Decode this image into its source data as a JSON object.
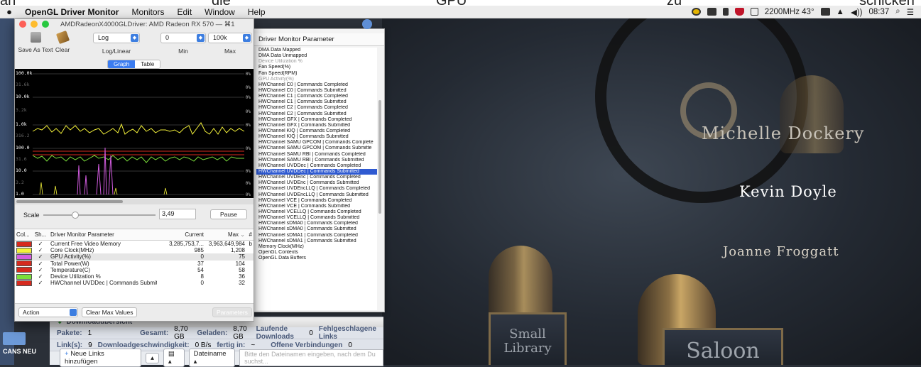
{
  "menubar": {
    "app_name": "OpenGL Driver Monitor",
    "menus": [
      "Monitors",
      "Edit",
      "Window",
      "Help"
    ],
    "cpu_speed": "2200MHz 43°",
    "clock": "08:37"
  },
  "top_strip": {
    "words": [
      "an",
      "die",
      "GPU",
      "zu",
      "schicken"
    ]
  },
  "window": {
    "title": "AMDRadeonX4000GLDriver: AMD Radeon RX 570 — ⌘1",
    "toolbar": {
      "save_label": "Save As Text",
      "clear_label": "Clear",
      "loglinear_value": "Log",
      "loglinear_label": "Log/Linear",
      "min_value": "0",
      "min_label": "Min",
      "max_value": "100k",
      "max_label": "Max"
    },
    "view_tabs": [
      "Graph",
      "Table"
    ],
    "active_tab": "Graph",
    "y_axis_labels": [
      "100.0k",
      "31.6k",
      "10.0k",
      "3.2k",
      "1.0k",
      "316.2",
      "100.0",
      "31.6",
      "10.0",
      "3.2",
      "1.0"
    ],
    "percent_labels": [
      "0%",
      "0%",
      "0%",
      "0%",
      "0%",
      "0%",
      "0%",
      "0%",
      "0%"
    ],
    "scale_label": "Scale",
    "scale_value": "3,49",
    "pause_label": "Pause",
    "table_headers": {
      "color": "Col...",
      "show": "Sh...",
      "name": "Driver Monitor Parameter",
      "current": "Current",
      "max": "Max",
      "hash": "#"
    },
    "parameters": [
      {
        "name": "Current Free Video Memory",
        "current": "3,285,753,7...",
        "max": "3,963,649,984",
        "unit": "b",
        "color": "#d62a1e",
        "shown": "✓"
      },
      {
        "name": "Core Clock(MHz)",
        "current": "985",
        "max": "1,208",
        "unit": "",
        "color": "#f4f23a",
        "shown": "✓"
      },
      {
        "name": "GPU Activity(%)",
        "current": "0",
        "max": "75",
        "unit": "",
        "color": "#d35ce0",
        "shown": "✓"
      },
      {
        "name": "Total Power(W)",
        "current": "37",
        "max": "104",
        "unit": "",
        "color": "#d62a1e",
        "shown": "✓"
      },
      {
        "name": "Temperature(C)",
        "current": "54",
        "max": "58",
        "unit": "",
        "color": "#d62a1e",
        "shown": "✓"
      },
      {
        "name": "Device Utilization %",
        "current": "8",
        "max": "36",
        "unit": "",
        "color": "#7be03a",
        "shown": "✓"
      },
      {
        "name": "HWChannel UVDDec | Commands Submitt",
        "current": "0",
        "max": "32",
        "unit": "",
        "color": "#d62a1e",
        "shown": "✓"
      }
    ],
    "action_label": "Action",
    "clear_max_label": "Clear Max Values",
    "parameters_button": "Parameters"
  },
  "drawer": {
    "header": "Driver Monitor Parameter",
    "items": [
      {
        "label": "DMA Data Mapped",
        "state": "normal"
      },
      {
        "label": "DMA Data Unmapped",
        "state": "normal"
      },
      {
        "label": "Device Utilization %",
        "state": "grey"
      },
      {
        "label": "Fan Speed(%)",
        "state": "normal"
      },
      {
        "label": "Fan Speed(RPM)",
        "state": "normal"
      },
      {
        "label": "GPU Activity(%)",
        "state": "grey"
      },
      {
        "label": "HWChannel C0 | Commands Completed",
        "state": "normal"
      },
      {
        "label": "HWChannel C0 | Commands Submitted",
        "state": "normal"
      },
      {
        "label": "HWChannel C1 | Commands Completed",
        "state": "normal"
      },
      {
        "label": "HWChannel C1 | Commands Submitted",
        "state": "normal"
      },
      {
        "label": "HWChannel C2 | Commands Completed",
        "state": "normal"
      },
      {
        "label": "HWChannel C2 | Commands Submitted",
        "state": "normal"
      },
      {
        "label": "HWChannel GFX | Commands Completed",
        "state": "normal"
      },
      {
        "label": "HWChannel GFX | Commands Submitted",
        "state": "normal"
      },
      {
        "label": "HWChannel KIQ | Commands Completed",
        "state": "normal"
      },
      {
        "label": "HWChannel KIQ | Commands Submitted",
        "state": "normal"
      },
      {
        "label": "HWChannel SAMU GPCOM | Commands Complete",
        "state": "normal"
      },
      {
        "label": "HWChannel SAMU GPCOM | Commands Submitte",
        "state": "normal"
      },
      {
        "label": "HWChannel SAMU RBI | Commands Completed",
        "state": "normal"
      },
      {
        "label": "HWChannel SAMU RBI | Commands Submitted",
        "state": "normal"
      },
      {
        "label": "HWChannel UVDDec | Commands Completed",
        "state": "normal"
      },
      {
        "label": "HWChannel UVDDec | Commands Submitted",
        "state": "selected"
      },
      {
        "label": "HWChannel UVDEnc | Commands Completed",
        "state": "normal"
      },
      {
        "label": "HWChannel UVDEnc | Commands Submitted",
        "state": "normal"
      },
      {
        "label": "HWChannel UVDEncLLQ | Commands Completed",
        "state": "normal"
      },
      {
        "label": "HWChannel UVDEncLLQ | Commands Submitted",
        "state": "normal"
      },
      {
        "label": "HWChannel VCE | Commands Completed",
        "state": "normal"
      },
      {
        "label": "HWChannel VCE | Commands Submitted",
        "state": "normal"
      },
      {
        "label": "HWChannel VCELLQ | Commands Completed",
        "state": "normal"
      },
      {
        "label": "HWChannel VCELLQ | Commands Submitted",
        "state": "normal"
      },
      {
        "label": "HWChannel sDMA0 | Commands Completed",
        "state": "normal"
      },
      {
        "label": "HWChannel sDMA0 | Commands Submitted",
        "state": "normal"
      },
      {
        "label": "HWChannel sDMA1 | Commands Completed",
        "state": "normal"
      },
      {
        "label": "HWChannel sDMA1 | Commands Submitted",
        "state": "normal"
      },
      {
        "label": "Memory Clock(MHz)",
        "state": "normal"
      },
      {
        "label": "OpenGL Contexts",
        "state": "normal"
      },
      {
        "label": "OpenGL Data Buffers",
        "state": "normal"
      }
    ]
  },
  "download_manager": {
    "title": "Downloadübersicht",
    "packages_label": "Pakete:",
    "packages_value": "1",
    "total_label": "Gesamt:",
    "total_value": "8,70 GB",
    "loaded_label": "Geladen:",
    "loaded_value": "8,70 GB",
    "running_label": "Laufende Downloads",
    "running_value": "0",
    "failed_label": "Fehlgeschlagene Links",
    "links_label": "Link(s):",
    "links_value": "9",
    "speed_label": "Downloadgeschwindigkeit:",
    "speed_value": "0 B/s",
    "done_label": "fertig in:",
    "done_value": "~",
    "open_label": "Offene Verbindungen",
    "open_value": "0",
    "add_links_label": "Neue Links hinzufügen",
    "filename_label": "Dateiname",
    "filename_placeholder": "Bitte den Dateinamen eingeben, nach dem Du suchst..."
  },
  "desktop": {
    "folder_label": "CANS NEU"
  },
  "video": {
    "credits": [
      "Michelle Dockery",
      "Kevin Doyle",
      "Joanne Froggatt"
    ],
    "sign_left": "Small Library",
    "sign_right": "Saloon"
  }
}
